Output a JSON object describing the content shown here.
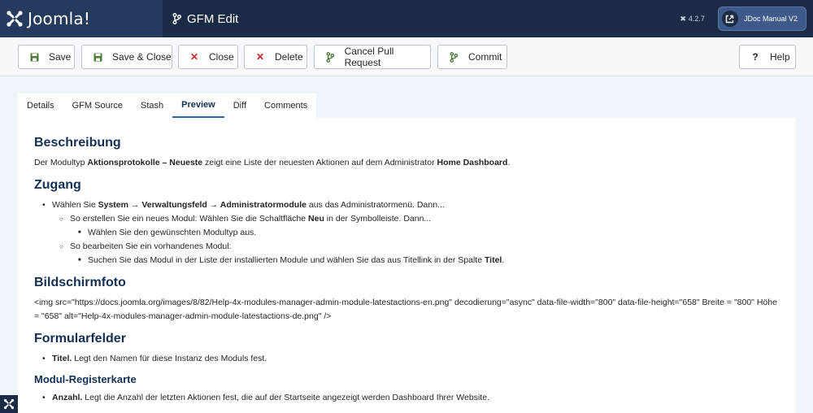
{
  "header": {
    "logo_text": "Joomla!",
    "title": "GFM Edit",
    "version": "4.2.7",
    "jdoc_label": "JDoc Manual V2"
  },
  "toolbar": {
    "save": "Save",
    "save_close": "Save & Close",
    "close": "Close",
    "delete": "Delete",
    "cancel_pr": "Cancel Pull Request",
    "commit": "Commit",
    "help": "Help"
  },
  "tabs": {
    "details": "Details",
    "gfm_source": "GFM Source",
    "stash": "Stash",
    "preview": "Preview",
    "diff": "Diff",
    "comments": "Comments"
  },
  "doc": {
    "h_beschreibung": "Beschreibung",
    "p1_a": "Der Modultyp ",
    "p1_b": "Aktionsprotokolle – Neueste",
    "p1_c": " zeigt eine Liste der neuesten Aktionen auf dem Administrator ",
    "p1_d": "Home Dashboard",
    "p1_e": ".",
    "h_zugang": "Zugang",
    "z1_a": "Wählen Sie ",
    "z1_b": "System → Verwaltungsfeld → Administratormodule",
    "z1_c": " aus das Administratormenü. Dann...",
    "z2_a": "So erstellen Sie ein neues Modul: Wählen Sie die Schaltfläche ",
    "z2_b": "Neu",
    "z2_c": " in der Symbolleiste. Dann...",
    "z3": "Wählen Sie den gewünschten Modultyp aus.",
    "z4": "So bearbeiten Sie ein vorhandenes Modul:",
    "z5_a": "Suchen Sie das Modul in der Liste der installierten Module und wählen Sie das aus Titellink in der Spalte ",
    "z5_b": "Titel",
    "z5_c": ".",
    "h_bild": "Bildschirmfoto",
    "img_text": "<img src=\"https://docs.joomla.org/images/8/82/Help-4x-modules-manager-admin-module-latestactions-en.png\" decodierung=\"async\" data-file-width=\"800\" data-file-height=\"658\" Breite = \"800\" Höhe = \"658\" alt=\"Help-4x-modules-manager-admin-module-latestactions-de.png\" />",
    "h_formular": "Formularfelder",
    "f1_a": "Titel.",
    "f1_b": " Legt den Namen für diese Instanz des Moduls fest.",
    "h_modul_reg": "Modul-Registerkarte",
    "m1_a": "Anzahl.",
    "m1_b": " Legt die Anzahl der letzten Aktionen fest, die auf der Startseite angezeigt werden Dashboard Ihrer Website."
  }
}
